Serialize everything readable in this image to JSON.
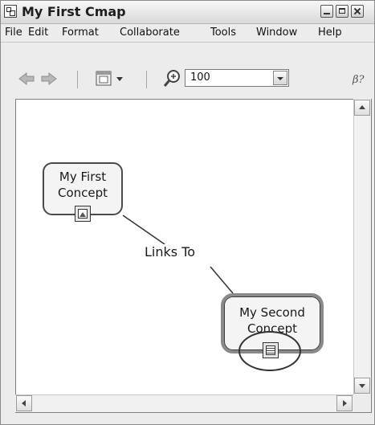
{
  "window": {
    "title": "My First Cmap",
    "controls": [
      "minimize",
      "maximize",
      "close"
    ]
  },
  "menu": {
    "items": [
      "File",
      "Edit",
      "Format",
      "Collaborate",
      "Tools",
      "Window",
      "Help"
    ]
  },
  "toolbar": {
    "zoom_value": "100",
    "icons": [
      "back-arrow-icon",
      "forward-arrow-icon",
      "view-options-icon",
      "zoom-icon",
      "help-icon"
    ]
  },
  "cmap": {
    "concepts": [
      {
        "lines": [
          "My First",
          "Concept"
        ],
        "resource_icon": "image-resource-icon"
      },
      {
        "lines": [
          "My Second",
          "Concept"
        ],
        "resource_icon": "document-resource-icon"
      }
    ],
    "link_label": "Links To"
  },
  "colors": {
    "window_bg": "#ececec",
    "canvas_bg": "#ffffff",
    "concept_bg": "#f4f4f4",
    "border": "#4a4a4a"
  }
}
